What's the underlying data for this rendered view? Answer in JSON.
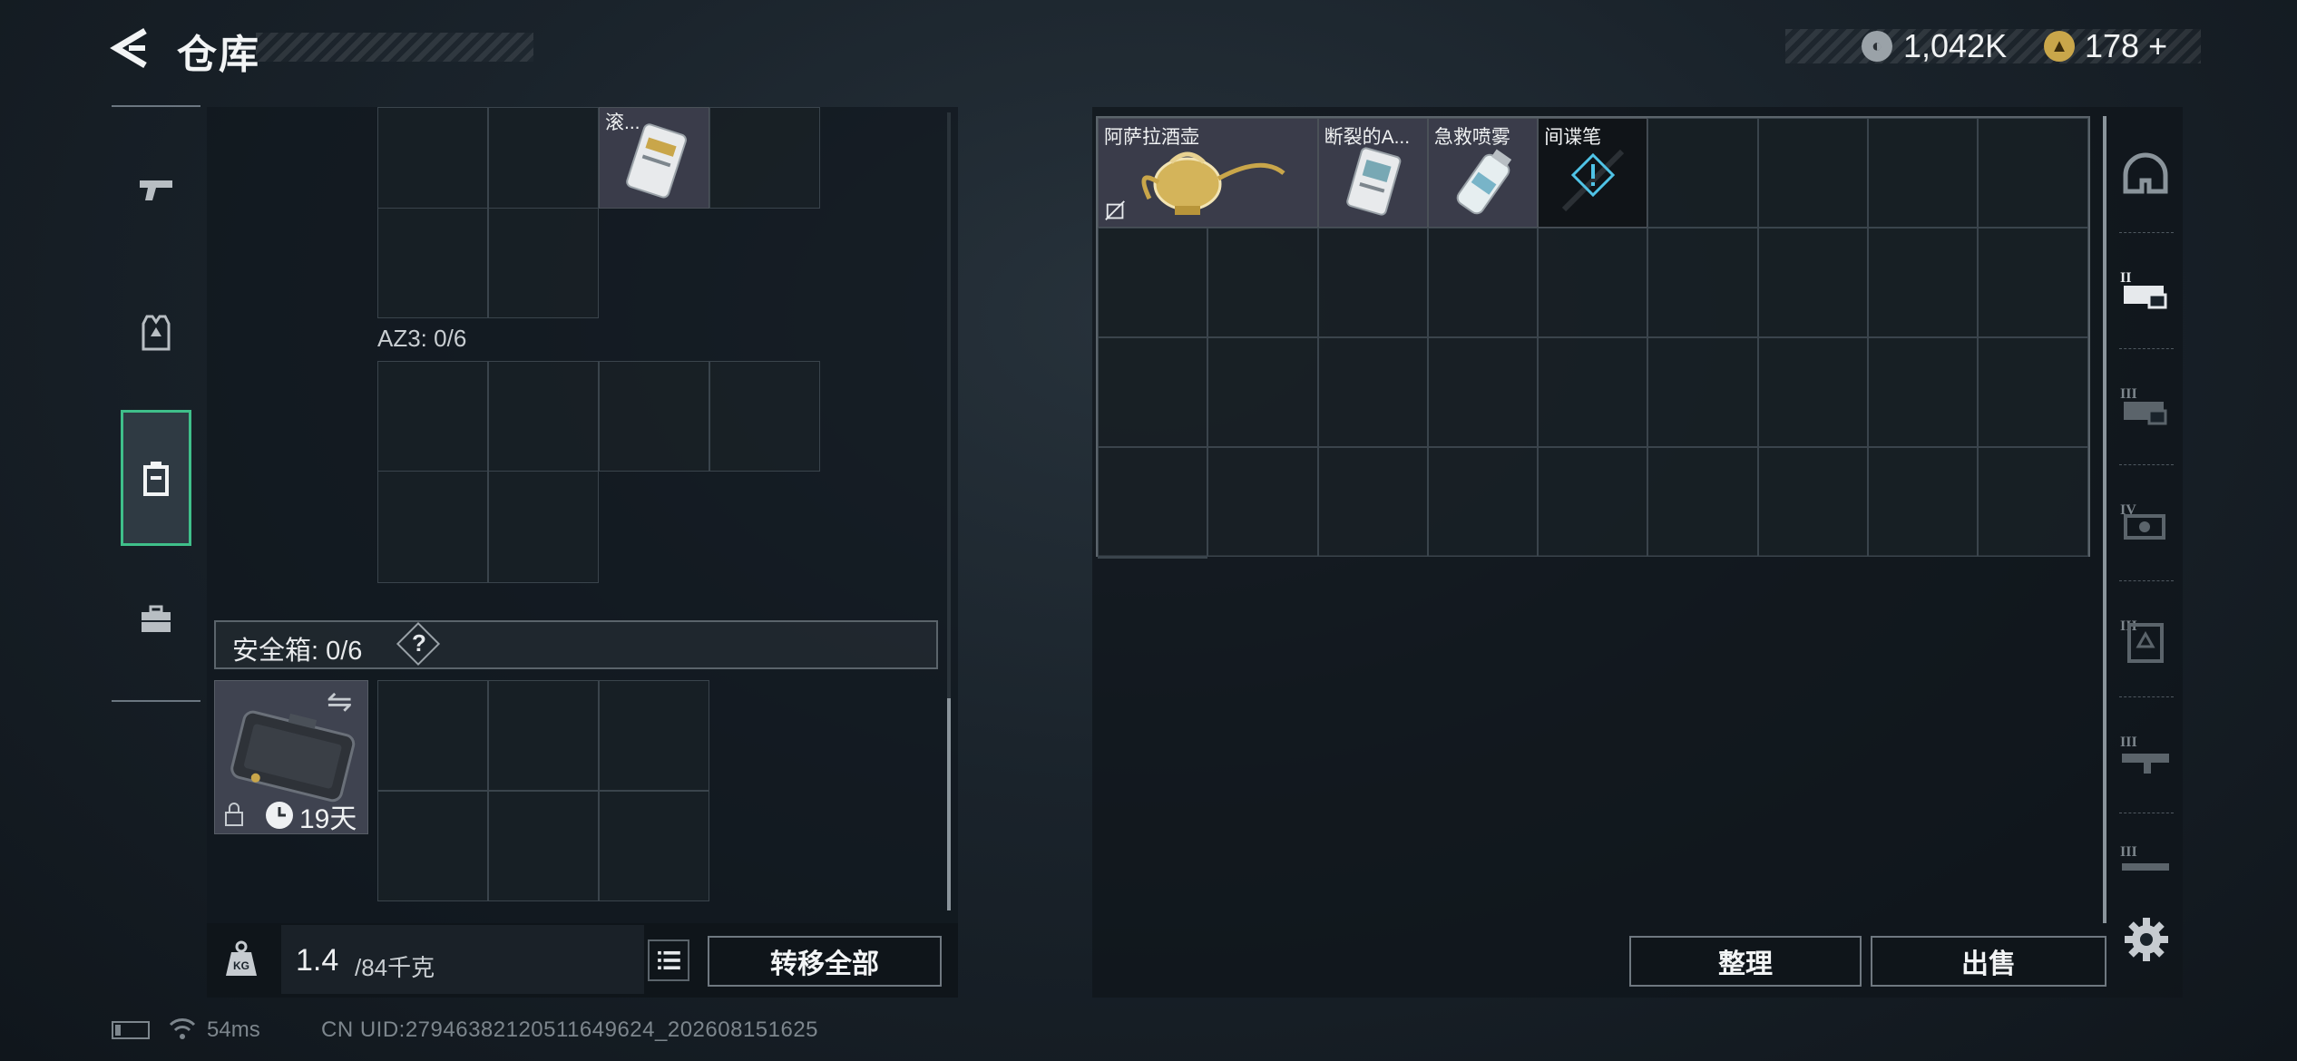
{
  "header": {
    "title": "仓库",
    "currency_silver": "1,042K",
    "currency_gold": "178",
    "currency_plus": "+"
  },
  "left_nav": {
    "items": [
      {
        "name": "weapons",
        "icon": "pistol-icon"
      },
      {
        "name": "equipment",
        "icon": "armor-vest-icon"
      },
      {
        "name": "backpack",
        "icon": "backpack-icon",
        "active": true
      },
      {
        "name": "briefcase",
        "icon": "briefcase-icon"
      }
    ]
  },
  "containers": {
    "top_partial_item_label": "滚...",
    "az3_label": "AZ3: 0/6"
  },
  "safe_box": {
    "label": "安全箱: 0/6",
    "help": "?",
    "days": "19天"
  },
  "weight": {
    "current": "1.4",
    "max": "/84千克"
  },
  "buttons": {
    "transfer_all": "转移全部",
    "sort": "整理",
    "sell": "出售"
  },
  "stash_items": [
    {
      "label": "阿萨拉酒壶",
      "icon": "golden-jug-icon"
    },
    {
      "label": "断裂的A...",
      "icon": "broken-card-icon"
    },
    {
      "label": "急救喷雾",
      "icon": "first-aid-spray-icon"
    },
    {
      "label": "间谍笔",
      "icon": "spy-pen-icon"
    }
  ],
  "right_nav": {
    "items": [
      {
        "name": "helmet",
        "icon": "helmet-icon"
      },
      {
        "name": "tier-2-weapons",
        "icon": "tier-2-gun-icon",
        "tier": "II"
      },
      {
        "name": "tier-3-weapons",
        "icon": "tier-3-gun-icon",
        "tier": "III"
      },
      {
        "name": "tier-4-weapons",
        "icon": "tier-4-gun-icon",
        "tier": "IV"
      },
      {
        "name": "tier-3-armor",
        "icon": "tier-3-armor-icon",
        "tier": "III"
      },
      {
        "name": "tier-3-rifles",
        "icon": "tier-3-rifle-icon",
        "tier": "III"
      },
      {
        "name": "tier-3-sniper",
        "icon": "tier-3-sniper-icon",
        "tier": "III"
      }
    ]
  },
  "footer": {
    "ping": "54ms",
    "uid": "CN UID:27946382120511649624_202608151625"
  },
  "colors": {
    "accent_green": "#3fbf8a",
    "gold_coin": "#c9a64a",
    "silver_coin": "#9aa2a8"
  }
}
